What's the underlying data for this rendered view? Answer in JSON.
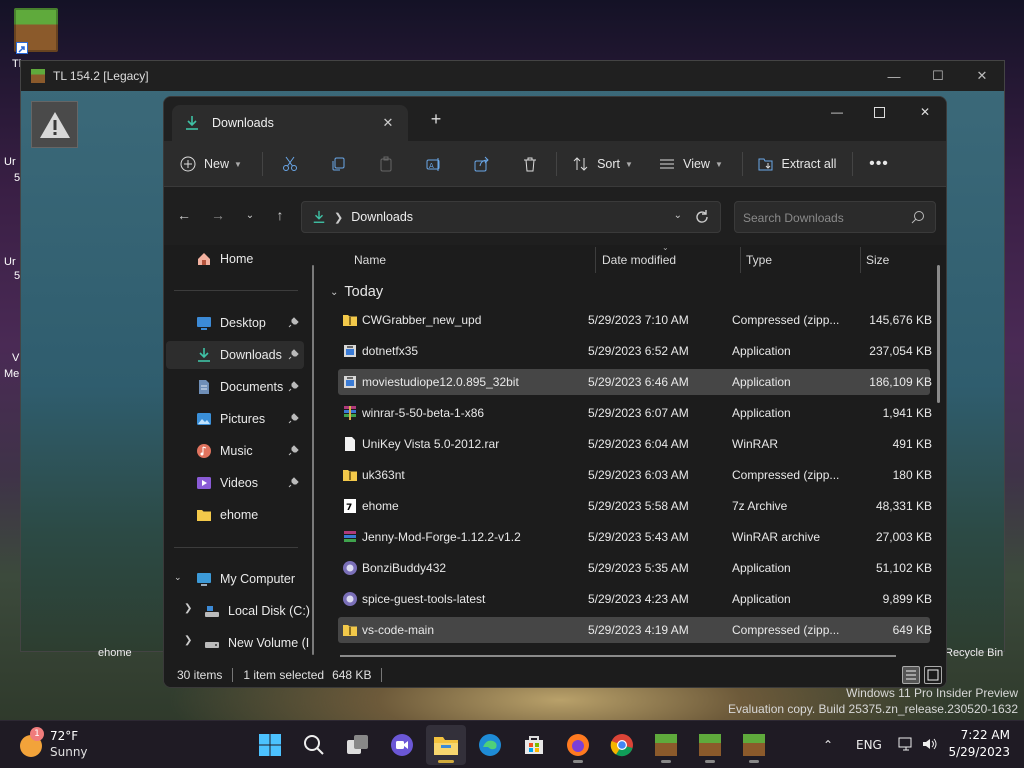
{
  "desktop": {
    "icons": [
      {
        "name": "minecraft-shortcut-icon",
        "label_fragment": "Tl"
      }
    ],
    "side_fragments": [
      "Ur",
      "5",
      "Ur",
      "5",
      "V",
      "Me"
    ],
    "bottom_labels": {
      "left": "ehome",
      "right": "Recycle Bin"
    }
  },
  "background_window": {
    "title": "TL 154.2 [Legacy]"
  },
  "explorer": {
    "tab": {
      "label": "Downloads"
    },
    "toolbar": {
      "new_label": "New",
      "sort_label": "Sort",
      "view_label": "View",
      "extract_all_label": "Extract all"
    },
    "address": {
      "location": "Downloads"
    },
    "search": {
      "placeholder": "Search Downloads"
    },
    "nav": {
      "items": [
        {
          "label": "Home",
          "icon": "home-icon"
        },
        {
          "label": "Desktop",
          "icon": "desktop-icon",
          "pinned": true
        },
        {
          "label": "Downloads",
          "icon": "download-icon",
          "pinned": true,
          "selected": true
        },
        {
          "label": "Documents",
          "icon": "documents-icon",
          "pinned": true
        },
        {
          "label": "Pictures",
          "icon": "pictures-icon",
          "pinned": true
        },
        {
          "label": "Music",
          "icon": "music-icon",
          "pinned": true
        },
        {
          "label": "Videos",
          "icon": "videos-icon",
          "pinned": true
        },
        {
          "label": "ehome",
          "icon": "folder-icon"
        },
        {
          "label": "My Computer",
          "icon": "computer-icon",
          "expanded": true
        },
        {
          "label": "Local Disk (C:)",
          "icon": "drive-icon"
        },
        {
          "label": "New Volume (I",
          "icon": "drive-icon"
        }
      ]
    },
    "columns": {
      "name": "Name",
      "date": "Date modified",
      "type": "Type",
      "size": "Size"
    },
    "group": "Today",
    "files": [
      {
        "name": "CWGrabber_new_upd",
        "date": "5/29/2023 7:10 AM",
        "type": "Compressed (zipp...",
        "size": "145,676 KB",
        "icon": "zip-folder-icon"
      },
      {
        "name": "dotnetfx35",
        "date": "5/29/2023 6:52 AM",
        "type": "Application",
        "size": "237,054 KB",
        "icon": "installer-icon"
      },
      {
        "name": "moviestudiope12.0.895_32bit",
        "date": "5/29/2023 6:46 AM",
        "type": "Application",
        "size": "186,109 KB",
        "icon": "installer-icon",
        "hover": true
      },
      {
        "name": "winrar-5-50-beta-1-x86",
        "date": "5/29/2023 6:07 AM",
        "type": "Application",
        "size": "1,941 KB",
        "icon": "winrar-icon"
      },
      {
        "name": "UniKey Vista 5.0-2012.rar",
        "date": "5/29/2023 6:04 AM",
        "type": "WinRAR",
        "size": "491 KB",
        "icon": "file-icon"
      },
      {
        "name": "uk363nt",
        "date": "5/29/2023 6:03 AM",
        "type": "Compressed (zipp...",
        "size": "180 KB",
        "icon": "zip-folder-icon"
      },
      {
        "name": "ehome",
        "date": "5/29/2023 5:58 AM",
        "type": "7z Archive",
        "size": "48,331 KB",
        "icon": "sevenzip-icon"
      },
      {
        "name": "Jenny-Mod-Forge-1.12.2-v1.2",
        "date": "5/29/2023 5:43 AM",
        "type": "WinRAR archive",
        "size": "27,003 KB",
        "icon": "winrar-archive-icon"
      },
      {
        "name": "BonziBuddy432",
        "date": "5/29/2023 5:35 AM",
        "type": "Application",
        "size": "51,102 KB",
        "icon": "app-icon"
      },
      {
        "name": "spice-guest-tools-latest",
        "date": "5/29/2023 4:23 AM",
        "type": "Application",
        "size": "9,899 KB",
        "icon": "app-icon"
      },
      {
        "name": "vs-code-main",
        "date": "5/29/2023 4:19 AM",
        "type": "Compressed (zipp...",
        "size": "649 KB",
        "icon": "zip-folder-icon",
        "selected": true
      }
    ],
    "status": {
      "count": "30 items",
      "selection": "1 item selected",
      "selection_size": "648 KB"
    }
  },
  "watermark": {
    "line1": "Windows 11 Pro Insider Preview",
    "line2": "Evaluation copy. Build 25375.zn_release.230520-1632"
  },
  "taskbar": {
    "weather": {
      "badge": "1",
      "temp": "72°F",
      "condition": "Sunny"
    },
    "apps": [
      "start-icon",
      "search-icon",
      "task-view-icon",
      "meet-icon",
      "file-explorer-icon",
      "edge-icon",
      "store-icon",
      "firefox-icon",
      "chrome-icon",
      "minecraft-icon",
      "minecraft-icon",
      "minecraft-icon"
    ],
    "language": "ENG",
    "time": "7:22 AM",
    "date": "5/29/2023"
  }
}
